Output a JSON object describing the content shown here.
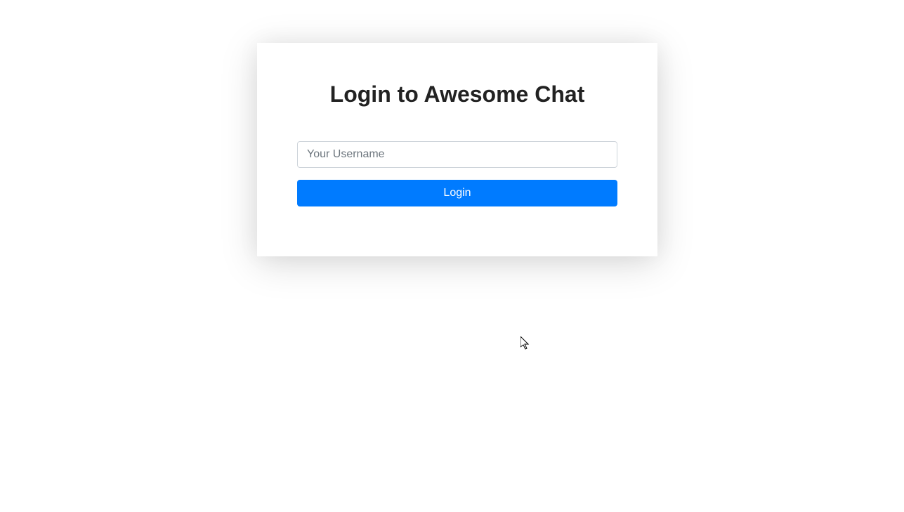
{
  "login": {
    "title": "Login to Awesome Chat",
    "username_placeholder": "Your Username",
    "username_value": "",
    "button_label": "Login"
  },
  "colors": {
    "primary": "#007bff",
    "text_dark": "#222222",
    "border": "#ced4da",
    "placeholder": "#6c757d"
  }
}
